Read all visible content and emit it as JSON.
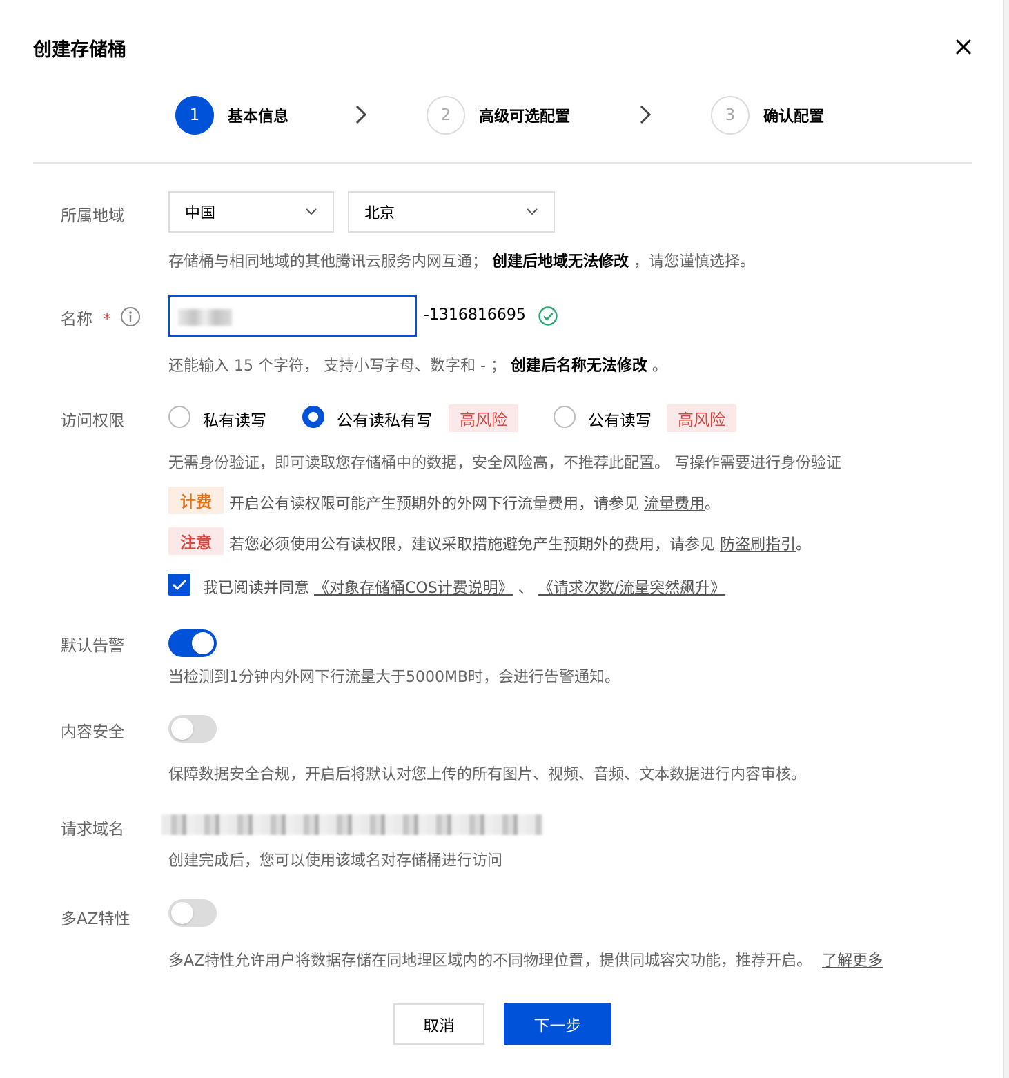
{
  "dialog": {
    "title": "创建存储桶"
  },
  "steps": [
    {
      "number": "1",
      "label": "基本信息"
    },
    {
      "number": "2",
      "label": "高级可选配置"
    },
    {
      "number": "3",
      "label": "确认配置"
    }
  ],
  "region": {
    "label": "所属地域",
    "country": "中国",
    "city": "北京",
    "help_prefix": "存储桶与相同地域的其他腾讯云服务内网互通；",
    "help_bold": "创建后地域无法修改",
    "help_suffix": "，请您谨慎选择。"
  },
  "name": {
    "label": "名称",
    "required_mark": "*",
    "suffix": "-1316816695",
    "help_prefix": "还能输入 15 个字符，  支持小写字母、数字和 - ；",
    "help_bold": "创建后名称无法修改",
    "help_suffix": "。"
  },
  "access": {
    "label": "访问权限",
    "options": [
      "私有读写",
      "公有读私有写",
      "公有读写"
    ],
    "selected": "公有读私有写",
    "risk_tag": "高风险",
    "description": "无需身份验证，即可读取您存储桶中的数据，安全风险高，不推荐此配置。 写操作需要进行身份验证",
    "fee_tag": "计费",
    "fee_text": "开启公有读权限可能产生预期外的外网下行流量费用，请参见",
    "fee_link": "流量费用",
    "fee_end": "。",
    "note_tag": "注意",
    "note_text": "若您必须使用公有读权限，建议采取措施避免产生预期外的费用，请参见",
    "note_link": "防盗刷指引",
    "note_end": "。",
    "agree_text": "我已阅读并同意",
    "agree_link1": "《对象存储桶COS计费说明》",
    "agree_sep": "、",
    "agree_link2": "《请求次数/流量突然飙升》",
    "agree_checked": true
  },
  "alarm": {
    "label": "默认告警",
    "enabled": true,
    "help": "当检测到1分钟内外网下行流量大于5000MB时，会进行告警通知。"
  },
  "content_security": {
    "label": "内容安全",
    "enabled": false,
    "help": "保障数据安全合规，开启后将默认对您上传的所有图片、视频、音频、文本数据进行内容审核。"
  },
  "request_domain": {
    "label": "请求域名",
    "help": "创建完成后，您可以使用该域名对存储桶进行访问"
  },
  "multi_az": {
    "label": "多AZ特性",
    "enabled": false,
    "help": "多AZ特性允许用户将数据存储在同地理区域内的不同物理位置，提供同城容灾功能，推荐开启。",
    "link": "了解更多"
  },
  "footer": {
    "cancel": "取消",
    "next": "下一步"
  },
  "colors": {
    "primary": "#0052d9",
    "danger": "#d54941",
    "warning": "#e37318",
    "success": "#2ba471"
  }
}
